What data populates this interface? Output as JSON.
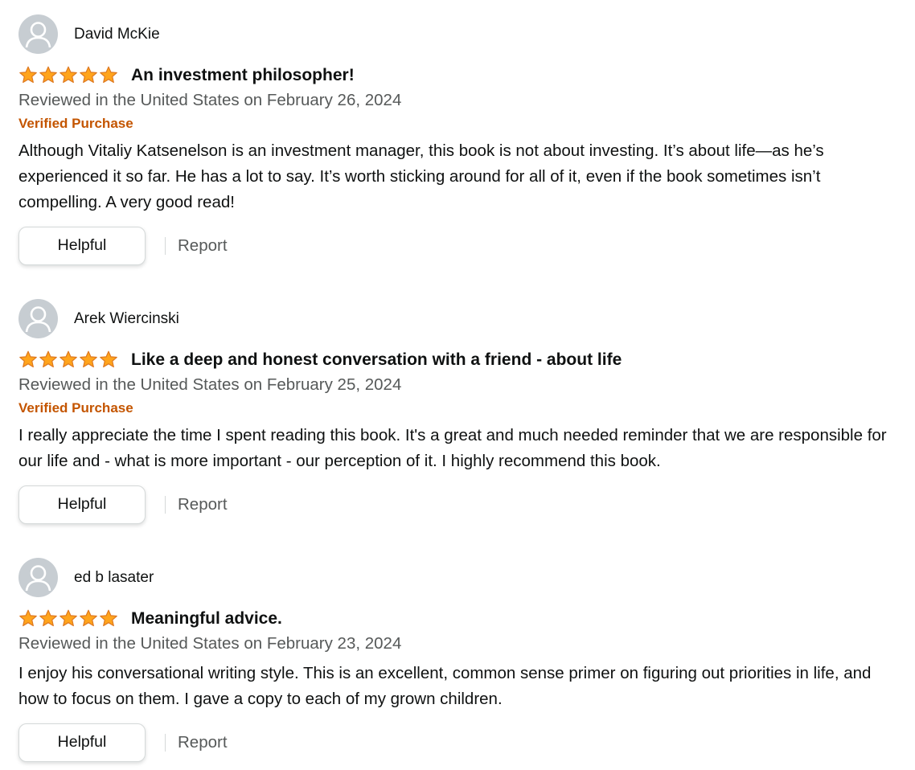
{
  "colors": {
    "star": "#ffa41c",
    "star_outline": "#de7921",
    "verified": "#c45500",
    "muted_text": "#565959",
    "avatar_bg": "#c7cdd2"
  },
  "reviews": [
    {
      "author": "David McKie",
      "rating": 5,
      "title": "An investment philosopher!",
      "date": "Reviewed in the United States on February 26, 2024",
      "verified": "Verified Purchase",
      "body": "Although Vitaliy Katsenelson is an investment manager, this book is not about investing. It’s about life—as he’s experienced it so far. He has a lot to say. It’s worth sticking around for all of it, even if the book sometimes isn’t compelling. A very good read!",
      "helpful_label": "Helpful",
      "report_label": "Report"
    },
    {
      "author": "Arek Wiercinski",
      "rating": 5,
      "title": "Like a deep and honest conversation with a friend - about life",
      "date": "Reviewed in the United States on February 25, 2024",
      "verified": "Verified Purchase",
      "body": "I really appreciate the time I spent reading this book. It's a great and much needed reminder that we are responsible for our life and - what is more important - our perception of it. I highly recommend this book.",
      "helpful_label": "Helpful",
      "report_label": "Report"
    },
    {
      "author": "ed b lasater",
      "rating": 5,
      "title": "Meaningful advice.",
      "date": "Reviewed in the United States on February 23, 2024",
      "body": "I enjoy his conversational writing style. This is an excellent, common sense primer on figuring out priorities in life, and how to focus on them. I gave a copy to each of my grown children.",
      "helpful_label": "Helpful",
      "report_label": "Report"
    }
  ]
}
